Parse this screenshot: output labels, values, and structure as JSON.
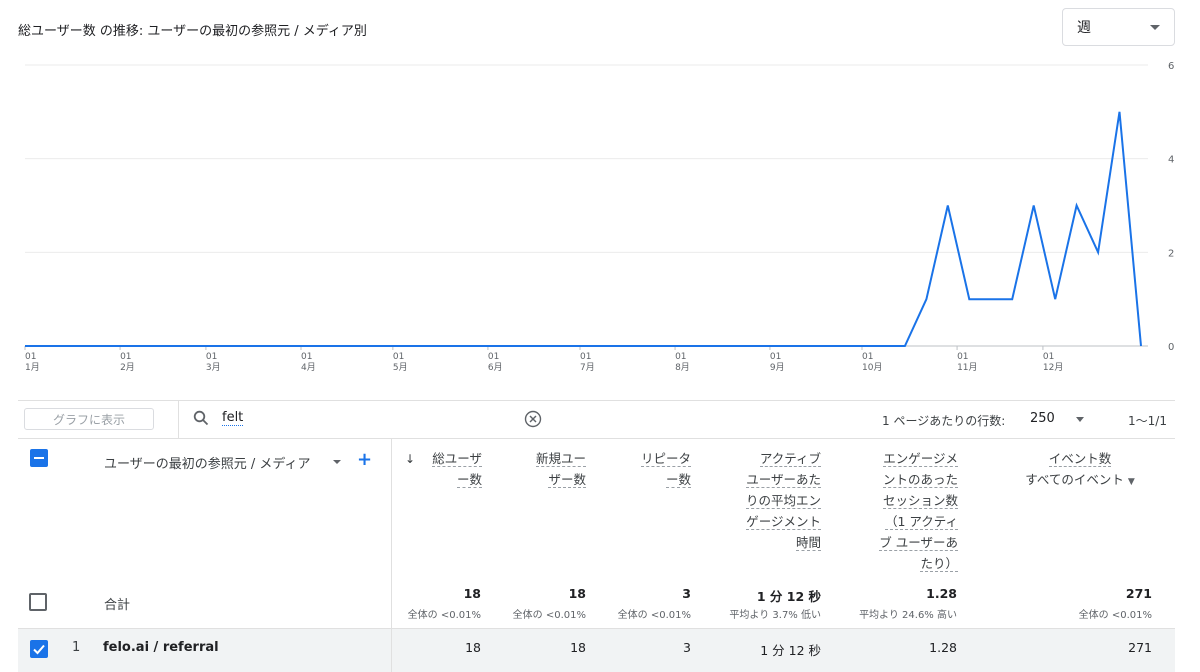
{
  "chart": {
    "title": "総ユーザー数 の推移: ユーザーの最初の参照元 / メディア別",
    "period_select": "週"
  },
  "chart_data": {
    "type": "line",
    "series": [
      {
        "values": [
          0,
          0,
          0,
          0,
          0,
          0,
          0,
          0,
          0,
          0,
          0,
          0,
          0,
          0,
          0,
          0,
          0,
          0,
          0,
          0,
          0,
          0,
          0,
          0,
          0,
          0,
          0,
          0,
          0,
          0,
          0,
          0,
          0,
          0,
          0,
          0,
          0,
          0,
          0,
          0,
          0,
          0,
          1,
          3,
          1,
          1,
          1,
          3,
          1,
          3,
          2,
          5,
          0
        ]
      }
    ],
    "x_tick_labels": [
      {
        "day": "01",
        "month": "1月"
      },
      {
        "day": "01",
        "month": "2月"
      },
      {
        "day": "01",
        "month": "3月"
      },
      {
        "day": "01",
        "month": "4月"
      },
      {
        "day": "01",
        "month": "5月"
      },
      {
        "day": "01",
        "month": "6月"
      },
      {
        "day": "01",
        "month": "7月"
      },
      {
        "day": "01",
        "month": "8月"
      },
      {
        "day": "01",
        "month": "9月"
      },
      {
        "day": "01",
        "month": "10月"
      },
      {
        "day": "01",
        "month": "11月"
      },
      {
        "day": "01",
        "month": "12月"
      }
    ],
    "x_tick_week_index": [
      0,
      4.43,
      8.43,
      12.86,
      17.14,
      21.57,
      25.86,
      30.29,
      34.71,
      39.0,
      43.43,
      47.43
    ],
    "y_ticks": [
      0,
      2,
      4,
      6
    ],
    "ylim": [
      0,
      6
    ],
    "grid": true,
    "line_color": "#1a73e8"
  },
  "toolbar": {
    "plot_button": "グラフに表示",
    "search_value": "felt",
    "rows_per_page_label": "1 ページあたりの行数:",
    "rows_per_page_value": "250",
    "range": "1〜1/1"
  },
  "table": {
    "dimension_header": "ユーザーの最初の参照元 / メディア",
    "columns": [
      {
        "lines": [
          "総ユーザ",
          "ー数"
        ]
      },
      {
        "lines": [
          "新規ユー",
          "ザー数"
        ]
      },
      {
        "lines": [
          "リピータ",
          "ー数"
        ]
      },
      {
        "lines": [
          "アクティブ",
          "ユーザーあた",
          "りの平均エン",
          "ゲージメント",
          "時間"
        ]
      },
      {
        "lines": [
          "エンゲージメ",
          "ントのあった",
          "セッション数",
          "（1 アクティ",
          "ブ ユーザーあ",
          "たり）"
        ]
      },
      {
        "lines": [
          "イベント数",
          "すべてのイベント"
        ]
      }
    ],
    "totals": {
      "label": "合計",
      "values": [
        "18",
        "18",
        "3",
        "1 分 12 秒",
        "1.28",
        "271"
      ],
      "subs": [
        "全体の <0.01%",
        "全体の <0.01%",
        "全体の <0.01%",
        "平均より 3.7% 低い",
        "平均より 24.6% 高い",
        "全体の <0.01%"
      ]
    },
    "rows": [
      {
        "index": "1",
        "dimension": "felo.ai / referral",
        "values": [
          "18",
          "18",
          "3",
          "1 分 12 秒",
          "1.28",
          "271"
        ]
      }
    ]
  }
}
